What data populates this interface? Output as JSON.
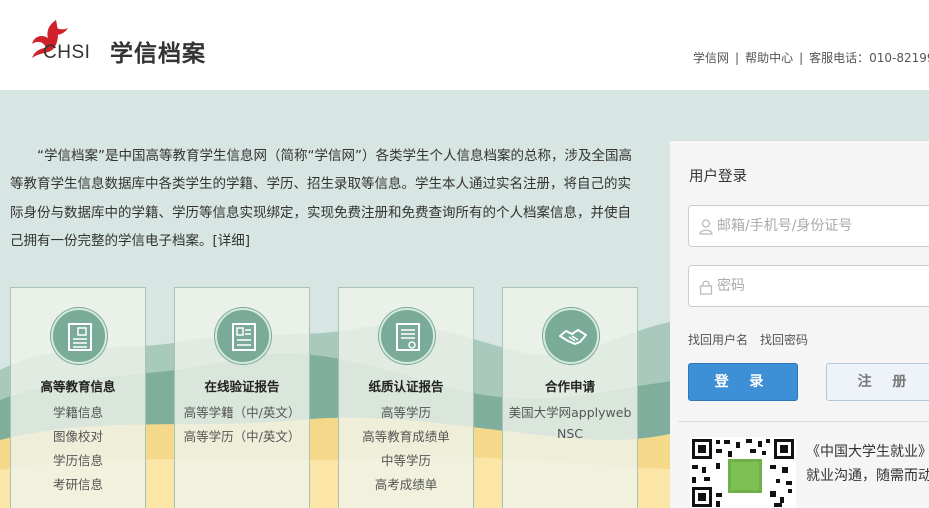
{
  "header": {
    "logo_text": "CHSI",
    "site_title": "学信档案",
    "links": [
      "学信网",
      "帮助中心"
    ],
    "service_phone": "客服电话：010-82199"
  },
  "intro": {
    "text": "“学信档案”是中国高等教育学生信息网（简称“学信网”）各类学生个人信息档案的总称，涉及全国高等教育学生信息数据库中各类学生的学籍、学历、招生录取等信息。学生本人通过实名注册，将自己的实际身份与数据库中的学籍、学历等信息实现绑定，实现免费注册和免费查询所有的个人档案信息，并使自己拥有一份完整的学信电子档案。",
    "more_link": "[详细]"
  },
  "cards": [
    {
      "title": "高等教育信息",
      "icon": "education-record-icon",
      "items": [
        "学籍信息",
        "图像校对",
        "学历信息",
        "考研信息"
      ]
    },
    {
      "title": "在线验证报告",
      "icon": "online-report-icon",
      "items": [
        "高等学籍（中/英文）",
        "高等学历（中/英文）"
      ]
    },
    {
      "title": "纸质认证报告",
      "icon": "paper-certificate-icon",
      "items": [
        "高等学历",
        "高等教育成绩单",
        "中等学历",
        "高考成绩单"
      ]
    },
    {
      "title": "合作申请",
      "icon": "handshake-icon",
      "items": [
        "美国大学网applyweb",
        "NSC"
      ]
    }
  ],
  "login": {
    "title": "用户登录",
    "username_placeholder": "邮箱/手机号/身份证号",
    "password_placeholder": "密码",
    "forgot_username": "找回用户名",
    "forgot_password": "找回密码",
    "login_button": "登 录",
    "register_button": "注 册",
    "promo_line1": "《中国大学生就业》",
    "promo_line2": "就业沟通，随需而动"
  },
  "colors": {
    "banner_bg": "#d8e6e3",
    "card_icon": "#79ab98",
    "login_button": "#3d8fd6",
    "hill_green": "#7fae9d",
    "sand_yellow": "#f5d98a"
  }
}
